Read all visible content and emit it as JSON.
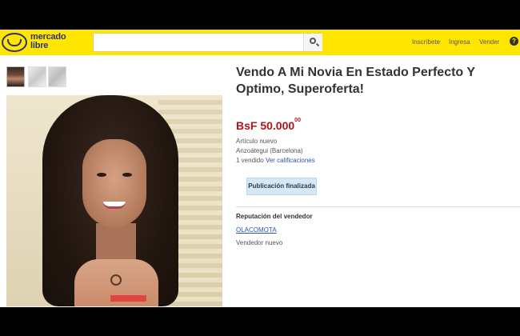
{
  "header": {
    "logo_line1": "mercado",
    "logo_line2": "libre",
    "search_value": "",
    "nav": [
      "Inscríbete",
      "Ingresa",
      "Vender"
    ],
    "help": "?"
  },
  "listing": {
    "title": "Vendo A Mi Novia En Estado Perfecto Y Optimo, Superoferta!",
    "price_main": "BsF 50.000",
    "price_cents": "00",
    "condition": "Artículo nuevo",
    "location": "Anzoátegui (Barcelona)",
    "sold_text": "1 vendido",
    "ratings_link": "Ver calificaciones",
    "status_button": "Publicación finalizada"
  },
  "seller": {
    "section_title": "Reputación del vendedor",
    "name": "OLACOMOTA",
    "status": "Vendedor nuevo"
  },
  "colors": {
    "header_bg": "#ffe600",
    "brand_navy": "#2d3277",
    "price_red": "#b3121b",
    "link_blue": "#2b55b1",
    "status_bg": "#d7e8f5"
  },
  "icons": [
    "handshake-logo-icon",
    "search-icon",
    "help-icon"
  ]
}
